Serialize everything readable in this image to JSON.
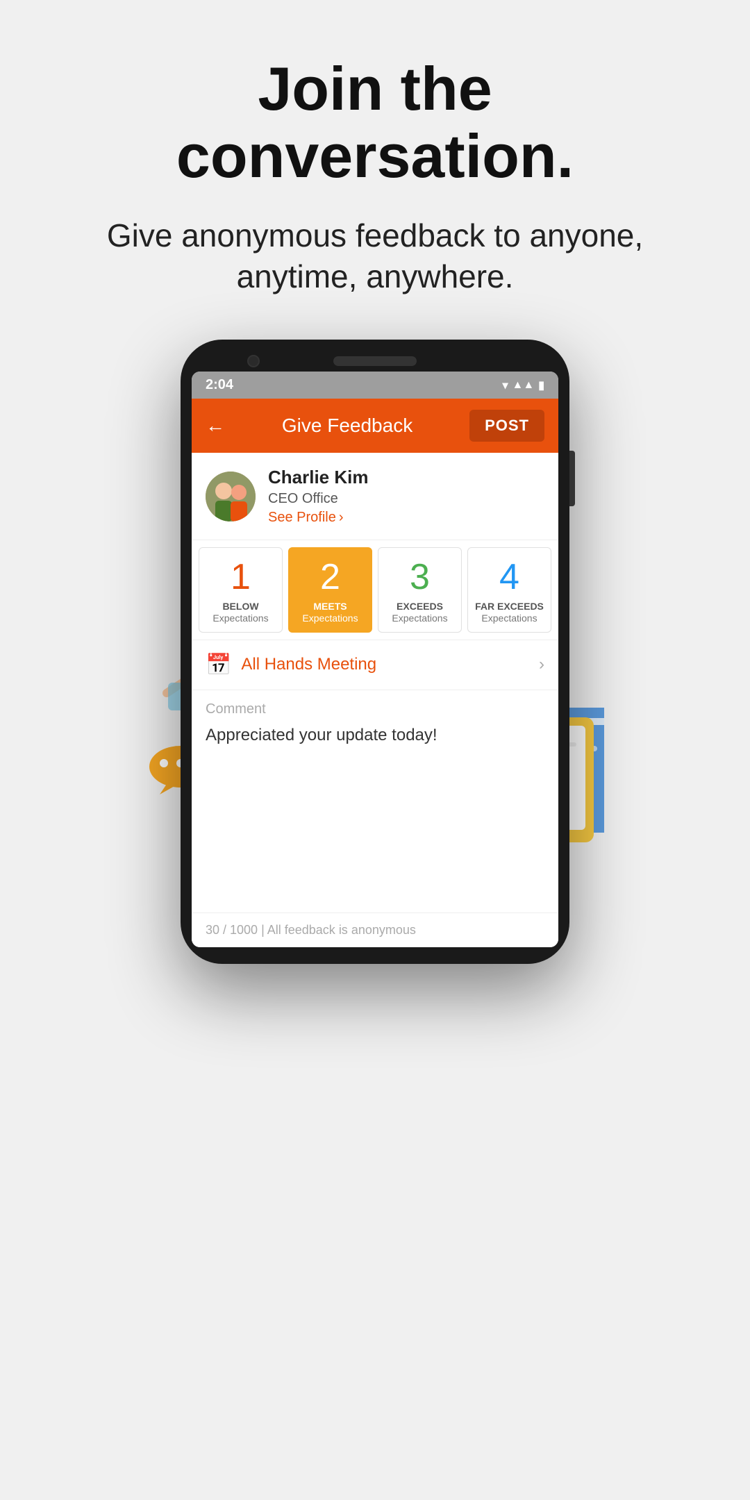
{
  "page": {
    "hero_title": "Join the conversation.",
    "hero_subtitle": "Give anonymous feedback to anyone, anytime, anywhere."
  },
  "phone": {
    "status_bar": {
      "time": "2:04",
      "icons": "▾◂▮"
    },
    "header": {
      "back_icon": "←",
      "title": "Give Feedback",
      "post_label": "POST"
    },
    "profile": {
      "name": "Charlie Kim",
      "role": "CEO Office",
      "see_profile": "See Profile",
      "chevron": "›"
    },
    "ratings": [
      {
        "number": "1",
        "label_top": "BELOW",
        "label_bottom": "Expectations",
        "active": false
      },
      {
        "number": "2",
        "label_top": "MEETS",
        "label_bottom": "Expectations",
        "active": true
      },
      {
        "number": "3",
        "label_top": "EXCEEDS",
        "label_bottom": "Expectations",
        "active": false
      },
      {
        "number": "4",
        "label_top": "FAR EXCEEDS",
        "label_bottom": "Expectations",
        "active": false
      }
    ],
    "meeting": {
      "icon": "📅",
      "label": "All Hands Meeting",
      "chevron": "›"
    },
    "comment": {
      "placeholder": "Comment",
      "text": "Appreciated your update today!"
    },
    "footer": {
      "text": "30 / 1000 | All feedback is anonymous"
    }
  },
  "colors": {
    "primary": "#e8510d",
    "active_rating": "#f5a623",
    "green": "#4caf50",
    "blue": "#2196f3"
  }
}
